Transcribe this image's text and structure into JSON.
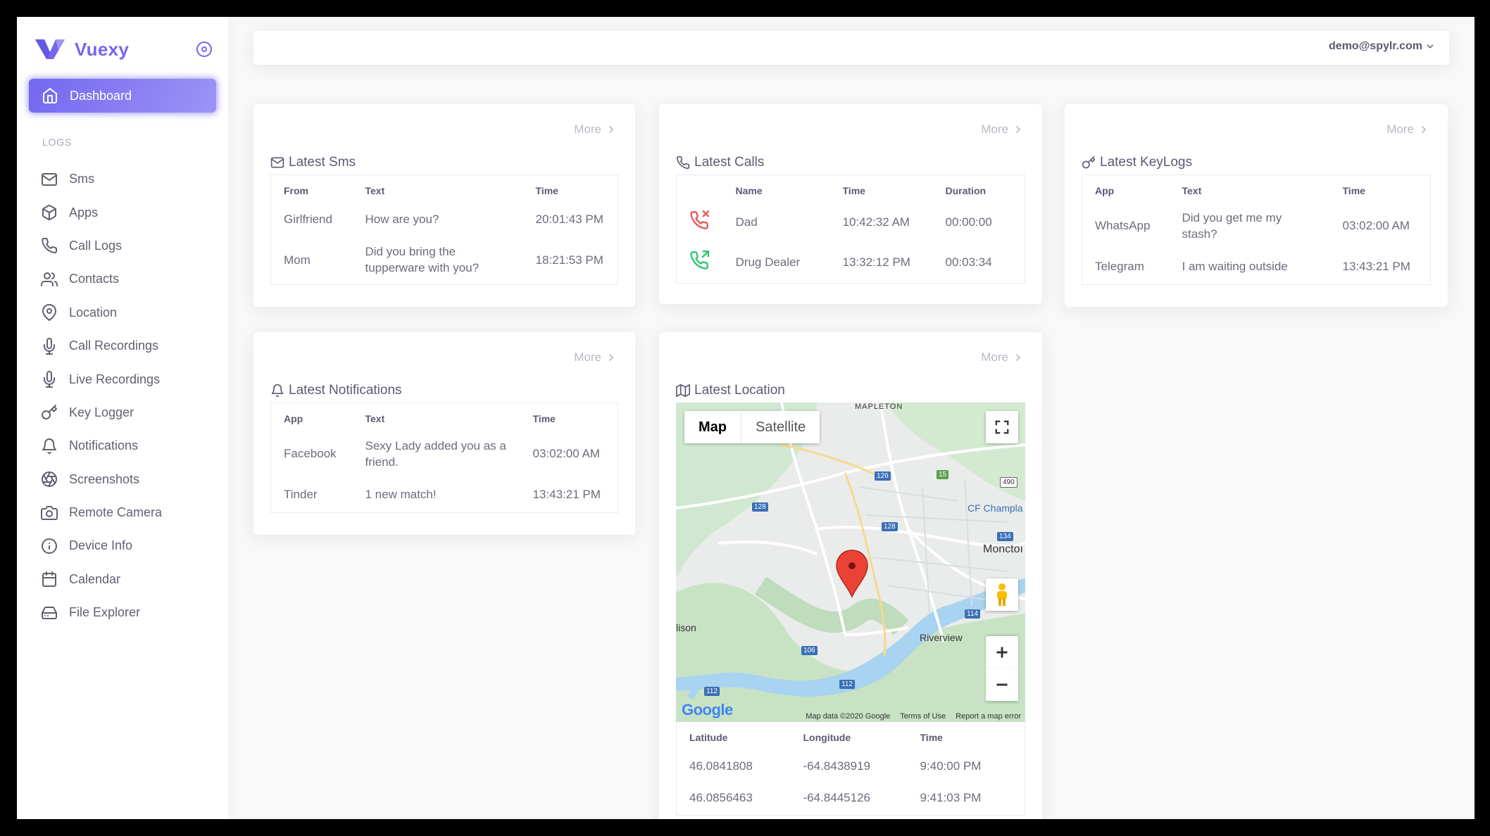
{
  "brand": {
    "name": "Vuexy",
    "logo_icon": "vuexy-logo-icon",
    "accent": "#7367f0"
  },
  "sidebar": {
    "active": {
      "label": "Dashboard",
      "icon": "home-icon"
    },
    "section_header": "LOGS",
    "items": [
      {
        "label": "Sms",
        "icon": "mail-icon"
      },
      {
        "label": "Apps",
        "icon": "box-icon"
      },
      {
        "label": "Call Logs",
        "icon": "phone-icon"
      },
      {
        "label": "Contacts",
        "icon": "users-icon"
      },
      {
        "label": "Location",
        "icon": "map-pin-icon"
      },
      {
        "label": "Call Recordings",
        "icon": "mic-icon"
      },
      {
        "label": "Live Recordings",
        "icon": "mic-icon"
      },
      {
        "label": "Key Logger",
        "icon": "key-icon"
      },
      {
        "label": "Notifications",
        "icon": "bell-icon"
      },
      {
        "label": "Screenshots",
        "icon": "aperture-icon"
      },
      {
        "label": "Remote Camera",
        "icon": "camera-icon"
      },
      {
        "label": "Device Info",
        "icon": "info-icon"
      },
      {
        "label": "Calendar",
        "icon": "calendar-icon"
      },
      {
        "label": "File Explorer",
        "icon": "hard-drive-icon"
      }
    ]
  },
  "topbar": {
    "user_email": "demo@spylr.com"
  },
  "cards": {
    "sms": {
      "more": "More",
      "title": "Latest Sms",
      "headers": [
        "From",
        "Text",
        "Time"
      ],
      "rows": [
        [
          "Girlfriend",
          "How are you?",
          "20:01:43 PM"
        ],
        [
          "Mom",
          "Did you bring the tupperware with you?",
          "18:21:53 PM"
        ]
      ]
    },
    "calls": {
      "more": "More",
      "title": "Latest Calls",
      "headers": [
        "",
        "Name",
        "Time",
        "Duration"
      ],
      "rows": [
        {
          "icon": "phone-missed-icon",
          "status_color": "#ea5455",
          "name": "Dad",
          "time": "10:42:32 AM",
          "duration": "00:00:00"
        },
        {
          "icon": "phone-outgoing-icon",
          "status_color": "#28c76f",
          "name": "Drug Dealer",
          "time": "13:32:12 PM",
          "duration": "00:03:34"
        }
      ]
    },
    "keylogs": {
      "more": "More",
      "title": "Latest KeyLogs",
      "headers": [
        "App",
        "Text",
        "Time"
      ],
      "rows": [
        [
          "WhatsApp",
          "Did you get me my stash?",
          "03:02:00 AM"
        ],
        [
          "Telegram",
          "I am waiting outside",
          "13:43:21 PM"
        ]
      ]
    },
    "notifications": {
      "more": "More",
      "title": "Latest Notifications",
      "headers": [
        "App",
        "Text",
        "Time"
      ],
      "rows": [
        [
          "Facebook",
          "Sexy Lady added you as a friend.",
          "03:02:00 AM"
        ],
        [
          "Tinder",
          "1 new match!",
          "13:43:21 PM"
        ]
      ]
    },
    "location": {
      "more": "More",
      "title": "Latest Location",
      "map": {
        "type_map": "Map",
        "type_satellite": "Satellite",
        "labels": {
          "mapleton": "MAPLETON",
          "champlain": "CF Champla",
          "moncton": "Monctoı",
          "riverview": "Riverview",
          "allison": "lison"
        },
        "shields": [
          "126",
          "15",
          "490",
          "128",
          "128",
          "134",
          "114",
          "106",
          "112",
          "112"
        ],
        "google": "Google",
        "footer": [
          "Map data ©2020 Google",
          "Terms of Use",
          "Report a map error"
        ]
      },
      "headers": [
        "Latitude",
        "Longitude",
        "Time"
      ],
      "rows": [
        [
          "46.0841808",
          "-64.8438919",
          "9:40:00 PM"
        ],
        [
          "46.0856463",
          "-64.8445126",
          "9:41:03 PM"
        ]
      ]
    }
  }
}
